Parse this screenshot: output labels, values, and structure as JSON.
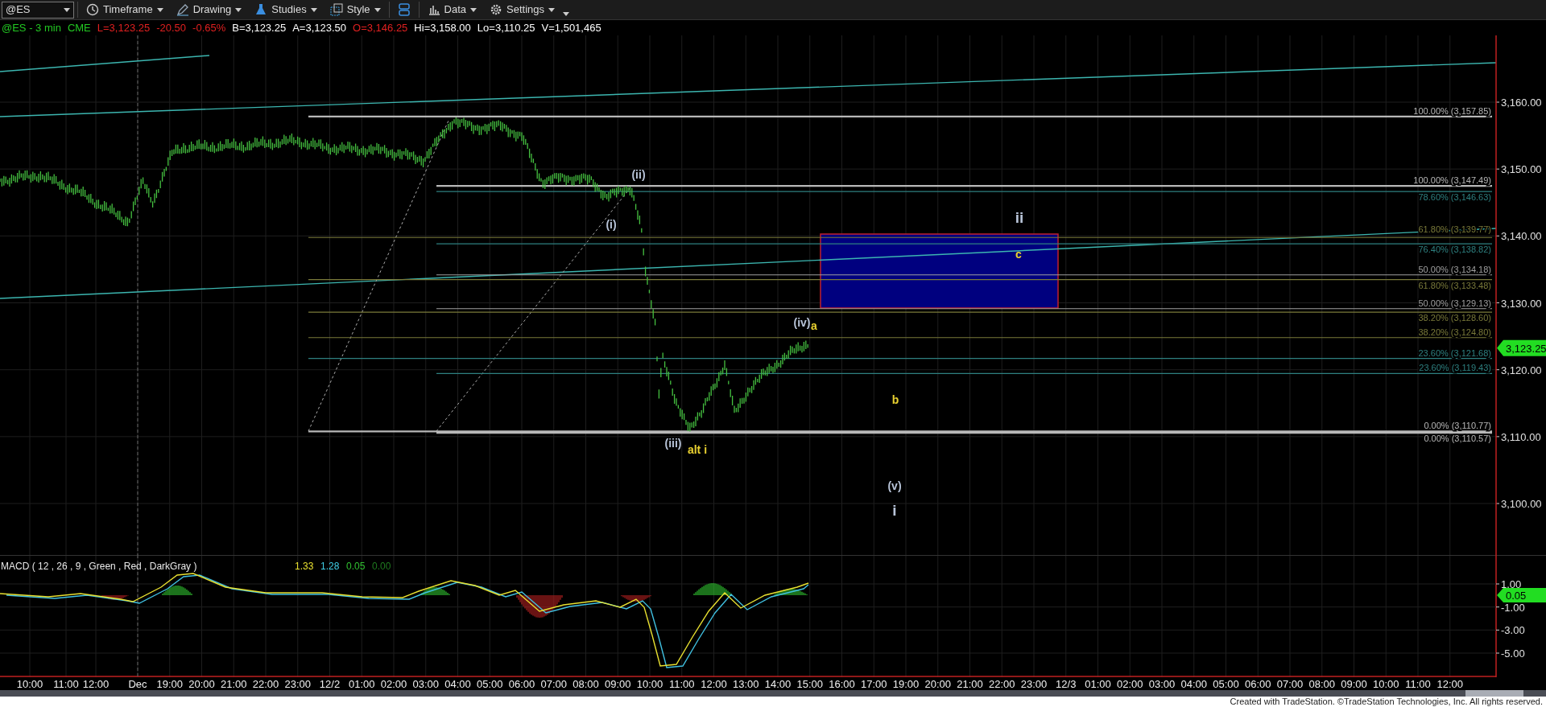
{
  "toolbar": {
    "symbol": "@ES",
    "menus": [
      {
        "kind": "clock",
        "label": "Timeframe"
      },
      {
        "kind": "pen",
        "label": "Drawing"
      },
      {
        "kind": "flask",
        "label": "Studies"
      },
      {
        "kind": "squares",
        "label": "Style"
      },
      {
        "kind": "layout"
      },
      {
        "kind": "bars",
        "label": "Data"
      },
      {
        "kind": "gear",
        "label": "Settings"
      }
    ]
  },
  "quote": [
    {
      "text": "@ES - 3 min",
      "color": "#22c822"
    },
    {
      "text": "CME",
      "color": "#22c822"
    },
    {
      "text": "L=3,123.25",
      "color": "#e02020"
    },
    {
      "text": "-20.50",
      "color": "#e02020"
    },
    {
      "text": "-0.65%",
      "color": "#e02020"
    },
    {
      "text": "B=3,123.25",
      "color": "#ffffff"
    },
    {
      "text": "A=3,123.50",
      "color": "#ffffff"
    },
    {
      "text": "O=3,146.25",
      "color": "#e02020"
    },
    {
      "text": "Hi=3,158.00",
      "color": "#ffffff"
    },
    {
      "text": "Lo=3,110.25",
      "color": "#ffffff"
    },
    {
      "text": "V=1,501,465",
      "color": "#ffffff"
    }
  ],
  "price_chart": {
    "fib_levels": [
      {
        "text": "100.00% (3,157.85)",
        "color": "#b8b8b8"
      },
      {
        "text": "100.00% (3,147.49)",
        "color": "#b8b8b8"
      },
      {
        "text": "78.60% (3,146.63)",
        "color": "#2e8080"
      },
      {
        "text": "61.80% (3,139.77)",
        "color": "#7a7a3a"
      },
      {
        "text": "76.40% (3,138.82)",
        "color": "#2e8080"
      },
      {
        "text": "50.00% (3,134.18)",
        "color": "#a0a0a0"
      },
      {
        "text": "61.80% (3,133.48)",
        "color": "#7a7a3a"
      },
      {
        "text": "50.00% (3,129.13)",
        "color": "#a0a0a0"
      },
      {
        "text": "38.20% (3,128.60)",
        "color": "#7a7a3a"
      },
      {
        "text": "38.20% (3,124.80)",
        "color": "#7a7a3a"
      },
      {
        "text": "23.60% (3,121.68)",
        "color": "#2e8080"
      },
      {
        "text": "23.60% (3,119.43)",
        "color": "#2e8080"
      },
      {
        "text": "0.00% (3,110.77)",
        "color": "#b8b8b8"
      },
      {
        "text": "0.00% (3,110.57)",
        "color": "#b8b8b8"
      }
    ],
    "wave_labels": [
      {
        "text": "(i)",
        "color": "#b8c4d8",
        "kind": "minor"
      },
      {
        "text": "(ii)",
        "color": "#b8c4d8",
        "kind": "minor"
      },
      {
        "text": "(iii)",
        "color": "#b8c4d8",
        "kind": "minor"
      },
      {
        "text": "alt i",
        "color": "#e8d030",
        "kind": "minor"
      },
      {
        "text": "(iv)",
        "color": "#b8c4d8",
        "kind": "minor"
      },
      {
        "text": "a",
        "color": "#e8d030",
        "kind": "minor"
      },
      {
        "text": "b",
        "color": "#e8d030",
        "kind": "minor"
      },
      {
        "text": "c",
        "color": "#e8d030",
        "kind": "minor"
      },
      {
        "text": "ii",
        "color": "#b8c4d8",
        "kind": "major"
      },
      {
        "text": "(v)",
        "color": "#b8c4d8",
        "kind": "minor"
      },
      {
        "text": "i",
        "color": "#b8c4d8",
        "kind": "major"
      }
    ],
    "price_axis": [
      "3,160.00",
      "3,150.00",
      "3,140.00",
      "3,130.00",
      "3,120.00",
      "3,110.00",
      "3,100.00"
    ],
    "last_price": "3,123.25"
  },
  "macd": {
    "title": "MACD ( 12 , 26 , 9 , Green , Red , DarkGray )",
    "values": [
      {
        "text": "1.33",
        "color": "#e8e030"
      },
      {
        "text": "1.28",
        "color": "#40d0e8"
      },
      {
        "text": "0.05",
        "color": "#30c030"
      },
      {
        "text": "0.00",
        "color": "#1f7a1f"
      }
    ],
    "axis": [
      "1.00",
      "-1.00",
      "-3.00",
      "-5.00"
    ],
    "last_value": "0.05"
  },
  "time_axis": [
    "10:00",
    "11:00",
    "12:00",
    "Dec",
    "19:00",
    "20:00",
    "21:00",
    "22:00",
    "23:00",
    "12/2",
    "01:00",
    "02:00",
    "03:00",
    "04:00",
    "05:00",
    "06:00",
    "07:00",
    "08:00",
    "09:00",
    "10:00",
    "11:00",
    "12:00",
    "13:00",
    "14:00",
    "15:00",
    "16:00",
    "17:00",
    "19:00",
    "20:00",
    "21:00",
    "22:00",
    "23:00",
    "12/3",
    "01:00",
    "02:00",
    "03:00",
    "04:00",
    "05:00",
    "06:00",
    "07:00",
    "08:00",
    "09:00",
    "10:00",
    "11:00",
    "12:00"
  ],
  "footer": "Created with TradeStation. ©TradeStation Technologies, Inc. All rights reserved."
}
